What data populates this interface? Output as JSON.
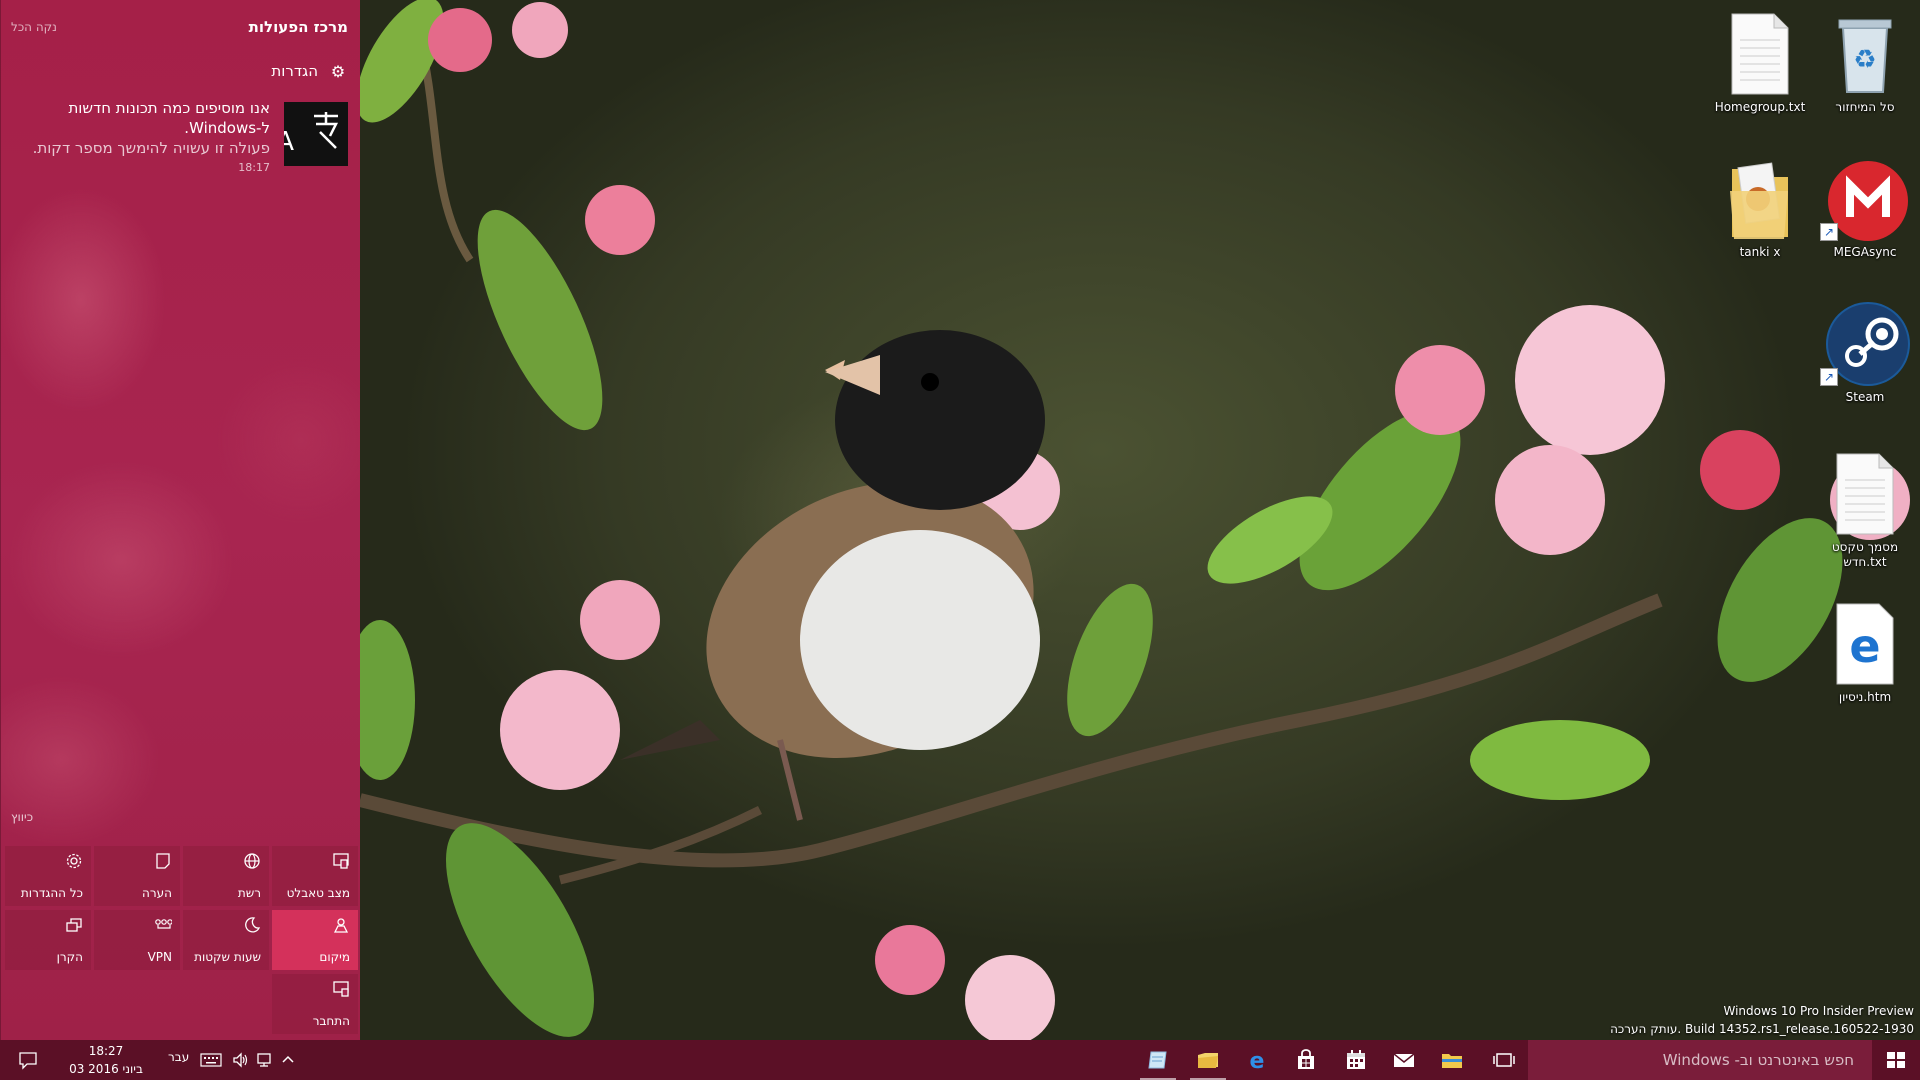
{
  "action_center": {
    "title": "מרכז הפעולות",
    "clear_all": "נקה הכל",
    "group_label": "הגדרות",
    "notification": {
      "title_line1": "אנו מוסיפים כמה תכונות חדשות",
      "title_line2": "ל-Windows.",
      "body": "פעולה זו עשויה להימשך מספר דקות.",
      "time": "18:17"
    },
    "collapse": "כיווץ",
    "tiles": [
      {
        "label": "מצב טאבלט",
        "icon": "tablet-mode-icon",
        "active": false
      },
      {
        "label": "רשת",
        "icon": "network-icon",
        "active": false
      },
      {
        "label": "הערה",
        "icon": "note-icon",
        "active": false
      },
      {
        "label": "כל ההגדרות",
        "icon": "settings-icon",
        "active": false
      },
      {
        "label": "מיקום",
        "icon": "location-icon",
        "active": true
      },
      {
        "label": "שעות שקטות",
        "icon": "quiet-hours-icon",
        "active": false
      },
      {
        "label": "VPN",
        "icon": "vpn-icon",
        "active": false
      },
      {
        "label": "הקרן",
        "icon": "project-icon",
        "active": false
      },
      {
        "label": "התחבר",
        "icon": "connect-icon",
        "active": false
      }
    ]
  },
  "desktop_icons": [
    {
      "label": "סל המיחזור",
      "icon": "recycle-bin-icon"
    },
    {
      "label": "Homegroup.txt",
      "icon": "text-file-icon"
    },
    {
      "label": "MEGAsync",
      "icon": "mega-icon"
    },
    {
      "label": "tanki x",
      "icon": "folder-icon"
    },
    {
      "label": "Steam",
      "icon": "steam-icon"
    },
    {
      "label": "מסמך טקסט חדש.txt",
      "icon": "text-file-icon"
    },
    {
      "label": "ניסיון.htm",
      "icon": "edge-file-icon"
    }
  ],
  "watermark": {
    "line1": "Windows 10 Pro Insider Preview",
    "line2": "עותק הערכה. Build 14352.rs1_release.160522-1930"
  },
  "taskbar": {
    "search_placeholder": "חפש באינטרנט וב- Windows",
    "language": "עבר",
    "time": "18:27",
    "date": "03 ביוני 2016",
    "colors": {
      "taskbar": "#5b1026",
      "accent": "#d4315b"
    }
  }
}
